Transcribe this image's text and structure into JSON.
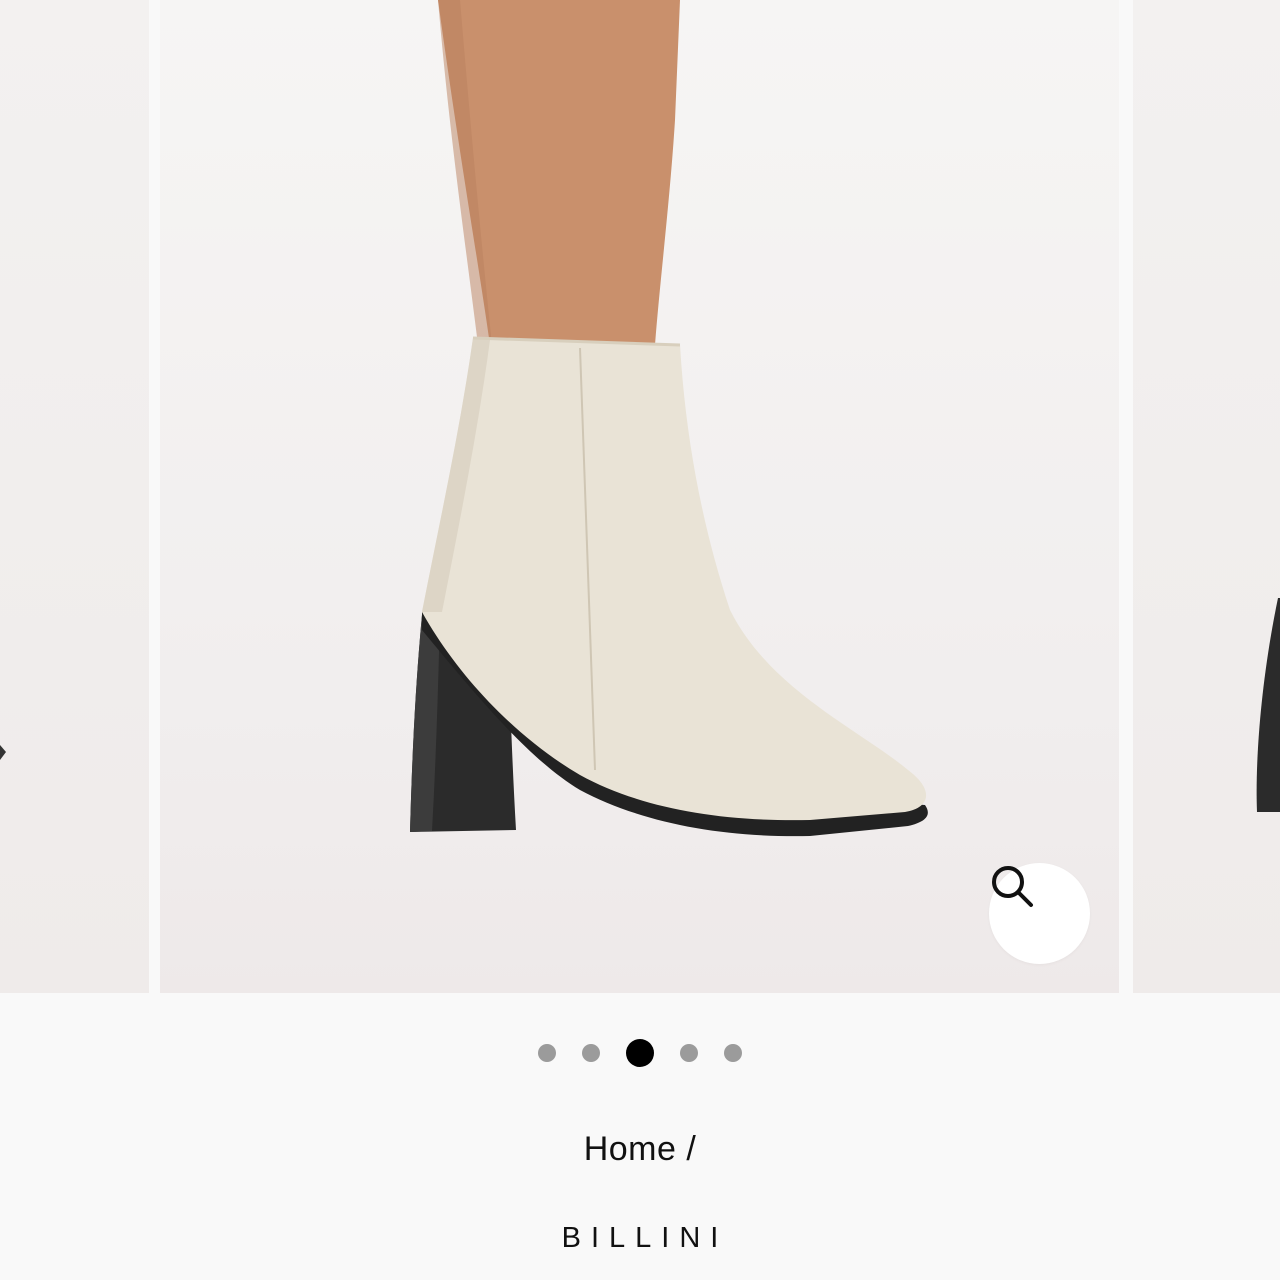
{
  "breadcrumb": {
    "home": "Home",
    "separator": "/"
  },
  "brand": {
    "name": "BILLINI"
  },
  "carousel": {
    "slide_count": 5,
    "active_index": 2
  },
  "icons": {
    "zoom": "search-icon"
  },
  "colors": {
    "dot_inactive": "#9b9b9b",
    "dot_active": "#000000",
    "boot": "#e9e3d6",
    "heel": "#2b2b2b"
  }
}
